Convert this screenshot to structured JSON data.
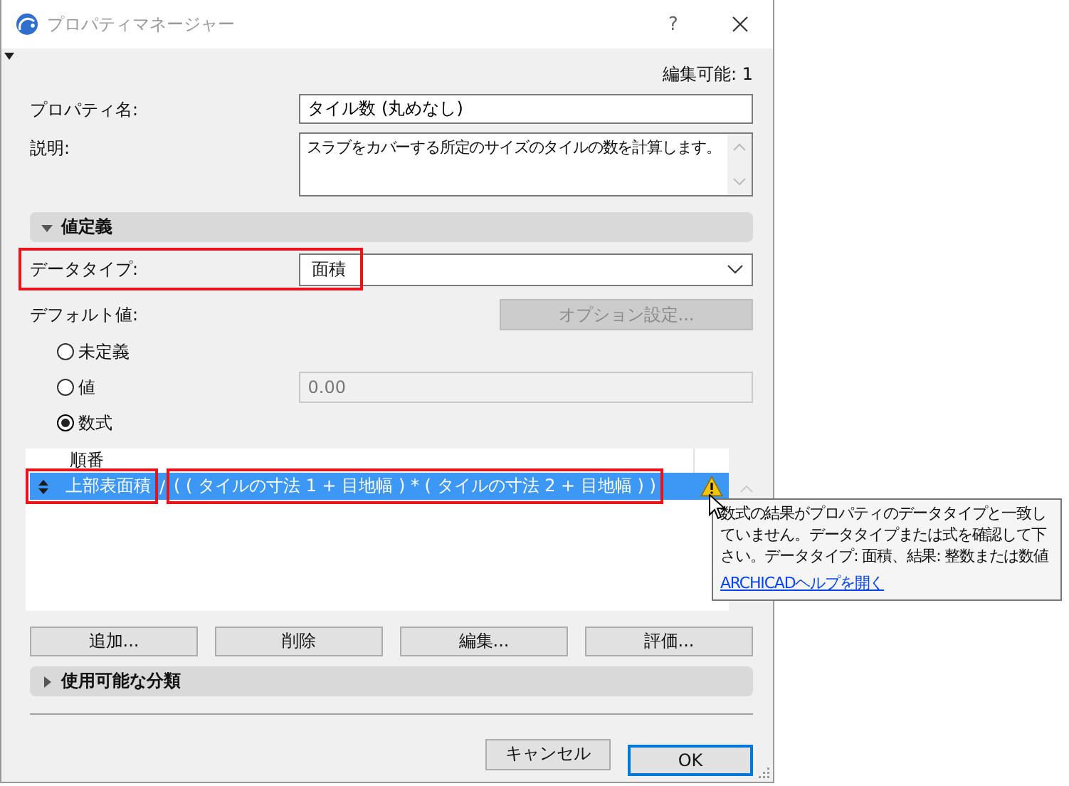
{
  "window": {
    "title": "プロパティマネージャー",
    "help": "?"
  },
  "edit_count": "編集可能: 1",
  "fields": [
    {
      "label": "プロパティ名:",
      "value": "タイル数 (丸めなし)",
      "kind": "input"
    },
    {
      "label": "説明:",
      "value": "スラブをカバーする所定のサイズのタイルの数を計算します。",
      "kind": "textarea"
    }
  ],
  "value_definition": {
    "title": "値定義",
    "expanded": true,
    "data_type": {
      "label": "データタイプ:",
      "value": "面積",
      "highlighted": true
    },
    "default_label": "デフォルト値:",
    "options_button": {
      "label": "オプション設定...",
      "disabled": true
    },
    "radios": [
      {
        "label": "未定義",
        "selected": false
      },
      {
        "label": "値",
        "selected": false,
        "value": "0.00",
        "disabled": true
      },
      {
        "label": "数式",
        "selected": true
      }
    ]
  },
  "formula_table": {
    "column": "順番",
    "rows": [
      {
        "selected": true,
        "parameter": "上部表面積",
        "operator": "/",
        "expression": "( ( タイルの寸法 1 + 目地幅 ) * ( タイルの寸法 2 + 目地幅 ) )",
        "warning": true,
        "highlighted": true
      }
    ]
  },
  "tooltip": {
    "text": "数式の結果がプロパティのデータタイプと一致していません。データタイプまたは式を確認して下さい。データタイプ: 面積、結果: 整数または数値",
    "link": "ARCHICADヘルプを開く"
  },
  "buttons": [
    "追加...",
    "削除",
    "編集...",
    "評価..."
  ],
  "classifications": {
    "title": "使用可能な分類",
    "expanded": false
  },
  "footer": [
    {
      "label": "キャンセル",
      "default": false
    },
    {
      "label": "OK",
      "default": true
    }
  ]
}
